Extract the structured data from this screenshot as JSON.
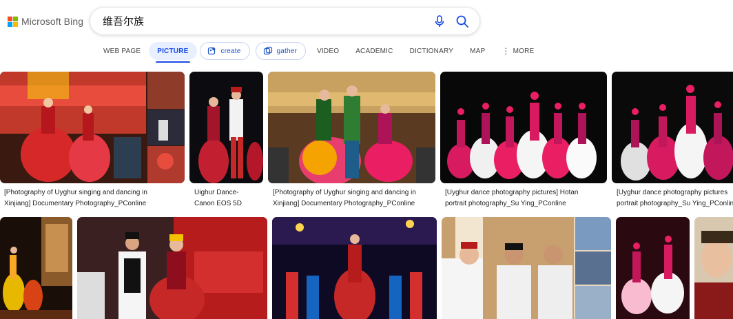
{
  "logo": {
    "text": "Microsoft Bing",
    "icon": "microsoft-logo-icon"
  },
  "search": {
    "query": "维吾尔族",
    "mic_icon": "microphone-icon",
    "search_icon": "search-icon"
  },
  "tabs": [
    {
      "label": "WEB PAGE",
      "active": false
    },
    {
      "label": "PICTURE",
      "active": true
    },
    {
      "label": "create",
      "type": "pill",
      "icon": "create-icon"
    },
    {
      "label": "gather",
      "type": "pill",
      "icon": "collection-icon"
    },
    {
      "label": "VIDEO",
      "active": false
    },
    {
      "label": "ACADEMIC",
      "active": false
    },
    {
      "label": "DICTIONARY",
      "active": false
    },
    {
      "label": "MAP",
      "active": false
    },
    {
      "label": "MORE",
      "active": false,
      "icon": "more-dots-icon"
    }
  ],
  "results_row1": [
    {
      "caption_line1": "[Photography of Uyghur singing and dancing in",
      "caption_line2": "Xinjiang] Documentary Photography_PConline"
    },
    {
      "caption_line1": "Uighur Dance-",
      "caption_line2": "Canon EOS 5D"
    },
    {
      "caption_line1": "[Photography of Uyghur singing and dancing in",
      "caption_line2": "Xinjiang] Documentary Photography_PConline"
    },
    {
      "caption_line1": "[Uyghur dance photography pictures] Hotan",
      "caption_line2": "portrait photography_Su Ying_PConline"
    },
    {
      "caption_line1": "[Uyghur dance photography pictures",
      "caption_line2": "portrait photography_Su Ying_PConline"
    }
  ],
  "colors": {
    "accent": "#174ae4",
    "active_tab_bg": "#e8efff"
  }
}
